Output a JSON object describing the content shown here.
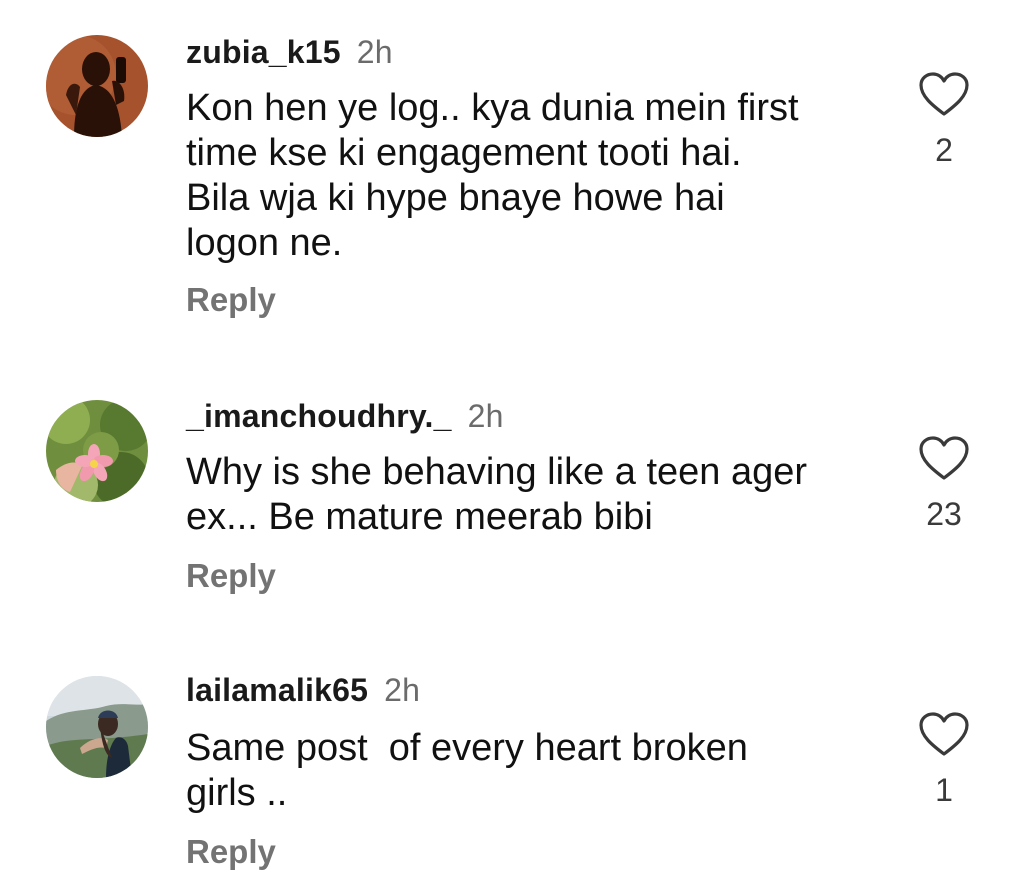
{
  "comments": [
    {
      "username": "zubia_k15",
      "time": "2h",
      "text": "Kon hen ye log.. kya dunia mein first\ntime kse ki engagement tooti hai.\nBila wja ki hype bnaye howe hai\nlogon ne.",
      "reply_label": "Reply",
      "like_count": "2",
      "avatar_icon": "silhouette-avatar"
    },
    {
      "username": "_imanchoudhry._",
      "time": "2h",
      "text": "Why is she behaving like a teen ager\nex... Be mature meerab bibi",
      "reply_label": "Reply",
      "like_count": "23",
      "avatar_icon": "flower-avatar"
    },
    {
      "username": "lailamalik65",
      "time": "2h",
      "text": "Same post  of every heart broken\ngirls ..",
      "reply_label": "Reply",
      "like_count": "1",
      "avatar_icon": "landscape-avatar"
    }
  ],
  "colors": {
    "text": "#111111",
    "meta": "#6b6b6b",
    "reply": "#737373",
    "background": "#ffffff"
  }
}
